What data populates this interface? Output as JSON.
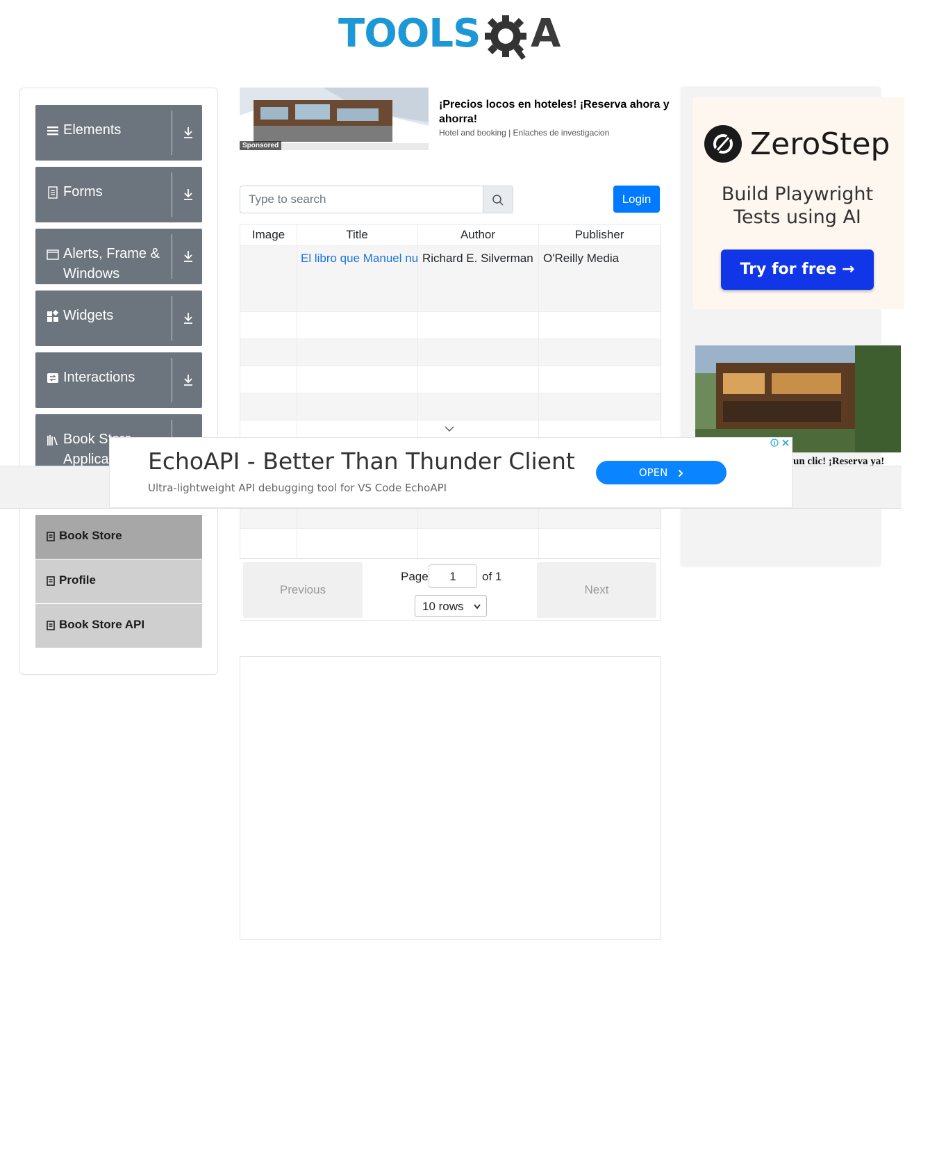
{
  "header": {
    "logo_text_main": "TOOLS",
    "logo_text_end": "A"
  },
  "sidebar": {
    "groups": [
      {
        "label": "Elements",
        "icon": "menu-icon"
      },
      {
        "label": "Forms",
        "icon": "document-icon"
      },
      {
        "label": "Alerts, Frame & Windows",
        "icon": "window-icon"
      },
      {
        "label": "Widgets",
        "icon": "widgets-icon"
      },
      {
        "label": "Interactions",
        "icon": "interactions-icon"
      },
      {
        "label": "Book Store Application",
        "icon": "books-icon"
      }
    ],
    "items": [
      {
        "label": "Book Store",
        "icon": "book-icon",
        "active": true
      },
      {
        "label": "Profile",
        "icon": "book-icon",
        "active": false
      },
      {
        "label": "Book Store API",
        "icon": "book-icon",
        "active": false
      }
    ]
  },
  "ad_top": {
    "badge": "Sponsored",
    "title": "¡Precios locos en hoteles! ¡Reserva ahora y ahorra!",
    "subtitle": "Hotel and booking | Enlaches de investigacion"
  },
  "search": {
    "placeholder": "Type to search",
    "value": ""
  },
  "login": {
    "label": "Login"
  },
  "table": {
    "headers": [
      "Image",
      "Title",
      "Author",
      "Publisher"
    ],
    "rows": [
      {
        "image": "",
        "title": "El libro que Manuel nur",
        "author": "Richard E. Silverman",
        "publisher": "O'Reilly Media"
      }
    ]
  },
  "pagination": {
    "previous": "Previous",
    "next": "Next",
    "page_label": "Page",
    "page_value": "1",
    "of_label": "of 1",
    "rows_option": "10 rows"
  },
  "ad_right": {
    "brand": "ZeroStep",
    "tagline": "Build Playwright Tests using AI",
    "cta": "Try for free →",
    "caption": "un clic! ¡Reserva ya!"
  },
  "ad_overlay": {
    "title": "EchoAPI - Better Than Thunder Client",
    "description": "Ultra-lightweight API debugging tool for VS Code EchoAPI",
    "cta": "OPEN"
  },
  "colors": {
    "primary": "#007bff",
    "sidebar_header": "#6c757d",
    "logo_blue": "#1b98d5",
    "cta_blue": "#1136e8"
  }
}
